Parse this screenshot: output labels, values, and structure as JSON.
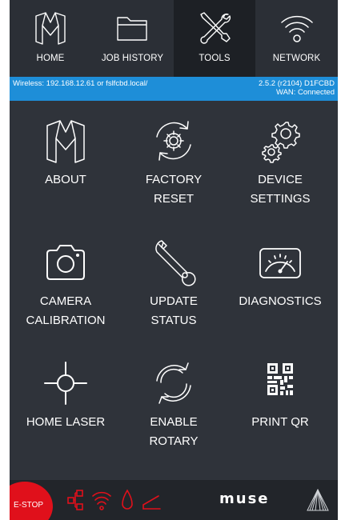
{
  "nav": {
    "tabs": [
      {
        "label": "HOME",
        "icon": "home-icon",
        "active": false
      },
      {
        "label": "JOB HISTORY",
        "icon": "folder-icon",
        "active": false
      },
      {
        "label": "TOOLS",
        "icon": "tools-icon",
        "active": true
      },
      {
        "label": "NETWORK",
        "icon": "wifi-icon",
        "active": false
      }
    ]
  },
  "status": {
    "connection": "Wireless: 192.168.12.61  or fslfcbd.local/",
    "version": "2.5.2 (r2104)  D1FCBD",
    "wan": "WAN: Connected"
  },
  "tools": [
    {
      "label": "ABOUT",
      "icon": "muse-logo-icon"
    },
    {
      "label": "FACTORY\nRESET",
      "icon": "factory-reset-icon"
    },
    {
      "label": "DEVICE\nSETTINGS",
      "icon": "gears-icon"
    },
    {
      "label": "CAMERA\nCALIBRATION",
      "icon": "camera-icon"
    },
    {
      "label": "UPDATE\nSTATUS",
      "icon": "wrench-icon"
    },
    {
      "label": "DIAGNOSTICS",
      "icon": "gauge-icon"
    },
    {
      "label": "HOME LASER",
      "icon": "crosshair-icon"
    },
    {
      "label": "ENABLE\nROTARY",
      "icon": "rotary-icon"
    },
    {
      "label": "PRINT QR",
      "icon": "qr-code-icon"
    }
  ],
  "bottom": {
    "estop_label": "E-STOP",
    "brand": "muse",
    "status_icons": [
      "network-icon",
      "wifi-icon",
      "water-drop-icon",
      "lid-icon"
    ]
  },
  "colors": {
    "background": "#2f333a",
    "nav_background": "#2b2f36",
    "nav_active": "#1d2025",
    "status_bar": "#1e8ed8",
    "estop": "#e0101b",
    "status_alert": "#e0101b"
  }
}
